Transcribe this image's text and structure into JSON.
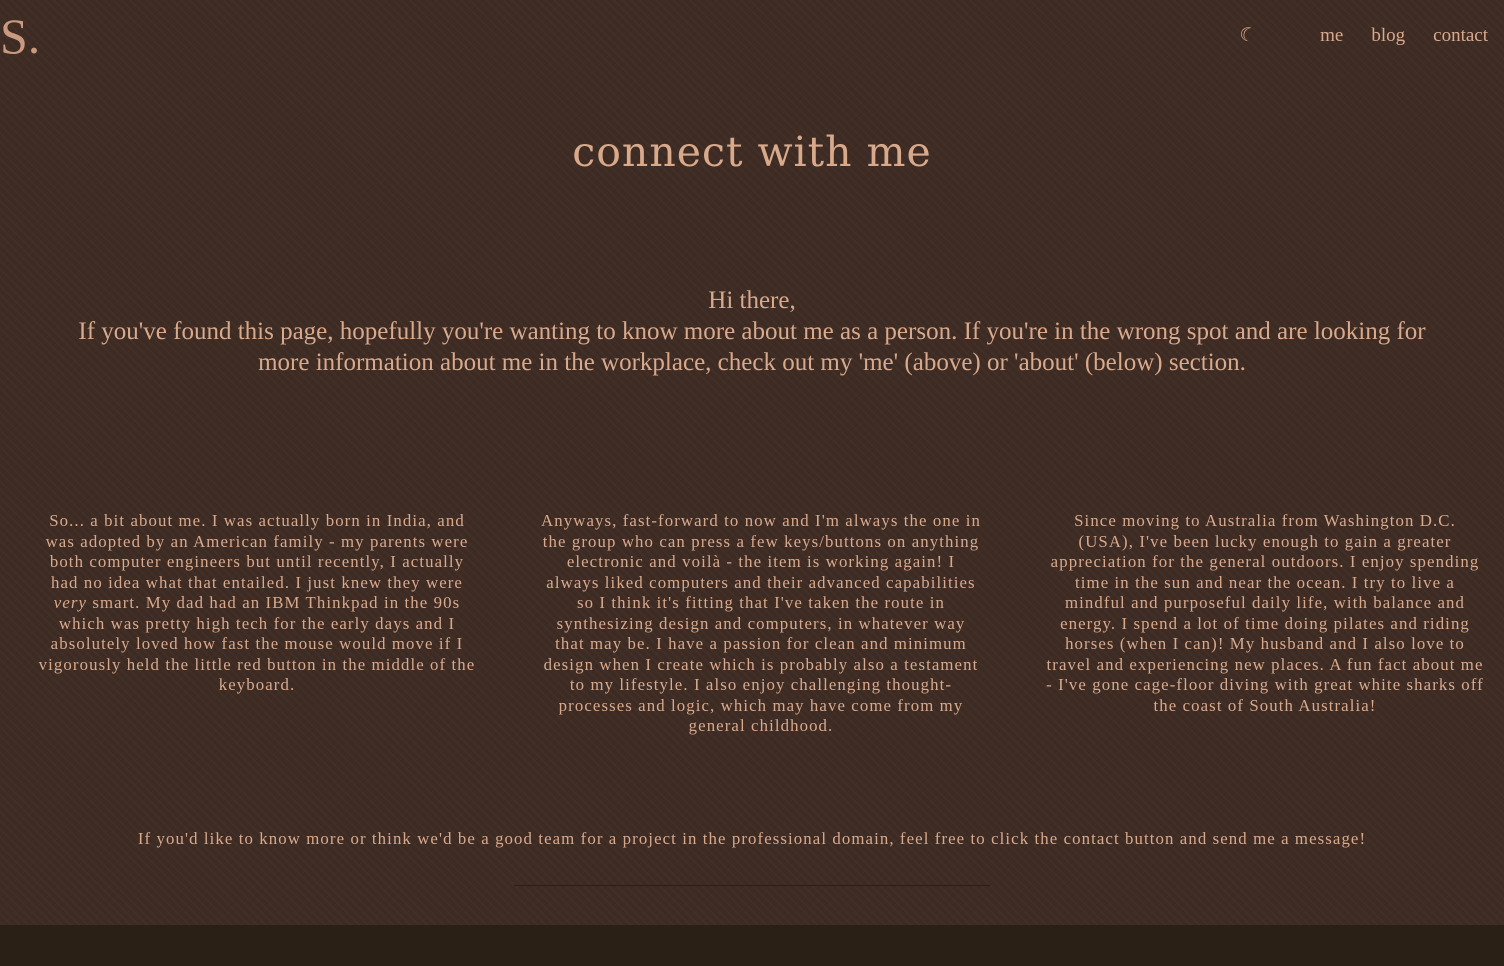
{
  "header": {
    "logo": "S.",
    "theme_toggle_glyph": "☾",
    "nav": [
      {
        "label": "me"
      },
      {
        "label": "blog"
      },
      {
        "label": "contact"
      }
    ]
  },
  "main": {
    "title": "connect with me",
    "intro_greeting": "Hi there,",
    "intro_body": "If you've found this page, hopefully you're wanting to know more about me as a person. If you're in the wrong spot and are looking for more information about me in the workplace, check out my 'me' (above) or 'about' (below) section.",
    "columns": [
      {
        "text_before_em": "So... a bit about me. I was actually born in India, and was adopted by an American family - my parents were both computer engineers but until recently, I actually had no idea what that entailed. I just knew they were ",
        "em": "very",
        "text_after_em": " smart. My dad had an IBM Thinkpad in the 90s which was pretty high tech for the early days and I absolutely loved how fast the mouse would move if I vigorously held the little red button in the middle of the keyboard."
      },
      {
        "text": "Anyways, fast-forward to now and I'm always the one in the group who can press a few keys/buttons on anything electronic and voilà - the item is working again! I always liked computers and their advanced capabilities so I think it's fitting that I've taken the route in synthesizing design and computers, in whatever way that may be. I have a passion for clean and minimum design when I create which is probably also a testament to my lifestyle. I also enjoy challenging thought-processes and logic, which may have come from my general childhood."
      },
      {
        "text": "Since moving to Australia from Washington D.C. (USA), I've been lucky enough to gain a greater appreciation for the general outdoors. I enjoy spending time in the sun and near the ocean. I try to live a mindful and purposeful daily life, with balance and energy. I spend a lot of time doing pilates and riding horses (when I can)! My husband and I also love to travel and experiencing new places. A fun fact about me - I've gone cage-floor diving with great white sharks off the coast of South Australia!"
      }
    ],
    "outro": "If you'd like to know more or think we'd be a good team for a project in the professional domain, feel free to click the contact button and send me a message!"
  },
  "colors": {
    "background": "#3e2c24",
    "text": "#d9a98c",
    "footer": "#2a2016"
  }
}
